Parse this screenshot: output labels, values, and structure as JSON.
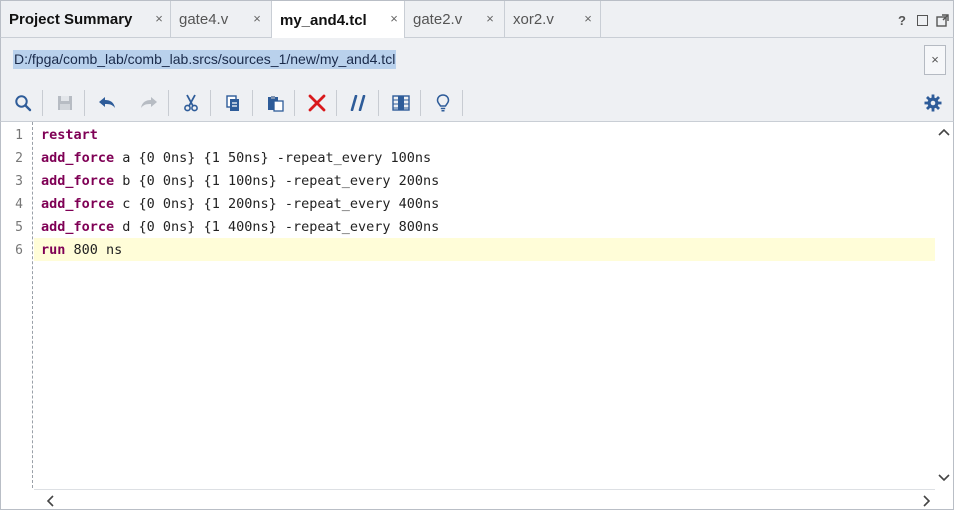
{
  "tabs": [
    {
      "label": "Project Summary",
      "active": false,
      "bold": true
    },
    {
      "label": "gate4.v",
      "active": false
    },
    {
      "label": "my_and4.tcl",
      "active": true
    },
    {
      "label": "gate2.v",
      "active": false
    },
    {
      "label": "xor2.v",
      "active": false
    }
  ],
  "tab_close_glyph": "×",
  "window_controls": {
    "help": "?"
  },
  "file_path": "D:/fpga/comb_lab/comb_lab.srcs/sources_1/new/my_and4.tcl",
  "path_close_glyph": "×",
  "toolbar_icons": [
    "search-icon",
    "save-icon",
    "undo-icon",
    "redo-icon",
    "cut-icon",
    "copy-icon",
    "paste-icon",
    "delete-icon",
    "comment-icon",
    "column-select-icon",
    "lightbulb-icon",
    "gear-icon"
  ],
  "colors": {
    "keyword": "#7f0055",
    "current_line": "#fffdd8",
    "delete_red": "#d9191c",
    "accent_blue": "#2e5c99"
  },
  "editor": {
    "lines": [
      {
        "num": "1",
        "keyword": "restart",
        "rest": ""
      },
      {
        "num": "2",
        "keyword": "add_force",
        "rest": " a {0 0ns} {1 50ns} -repeat_every 100ns"
      },
      {
        "num": "3",
        "keyword": "add_force",
        "rest": " b {0 0ns} {1 100ns} -repeat_every 200ns"
      },
      {
        "num": "4",
        "keyword": "add_force",
        "rest": " c {0 0ns} {1 200ns} -repeat_every 400ns"
      },
      {
        "num": "5",
        "keyword": "add_force",
        "rest": " d {0 0ns} {1 400ns} -repeat_every 800ns"
      },
      {
        "num": "6",
        "keyword": "run",
        "rest": " 800 ns"
      }
    ],
    "current_line": 6
  }
}
